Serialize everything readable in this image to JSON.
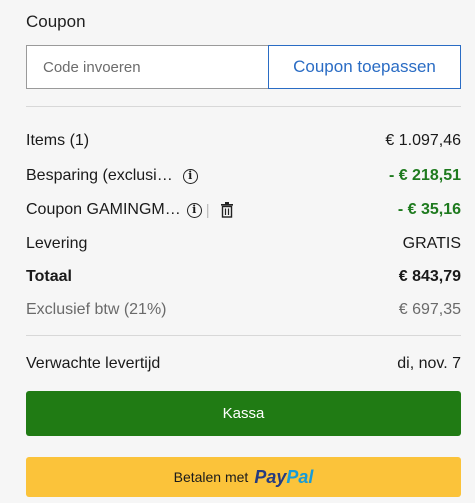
{
  "coupon": {
    "title": "Coupon",
    "input_placeholder": "Code invoeren",
    "input_value": "",
    "apply_label": "Coupon toepassen"
  },
  "summary": {
    "items_label": "Items (1)",
    "items_value": "€ 1.097,46",
    "savings_label": "Besparing (exclusi…",
    "savings_value": "- € 218,51",
    "coupon_label": "Coupon GAMINGM…",
    "coupon_sep": "|",
    "coupon_value": "- € 35,16",
    "delivery_label": "Levering",
    "delivery_value": "GRATIS",
    "total_label": "Totaal",
    "total_value": "€ 843,79",
    "vat_label": "Exclusief btw (21%)",
    "vat_value": "€ 697,35"
  },
  "delivery_estimate": {
    "label": "Verwachte levertijd",
    "value": "di, nov. 7"
  },
  "actions": {
    "checkout_label": "Kassa",
    "paypal_prefix": "Betalen met",
    "paypal_logo_part1": "Pay",
    "paypal_logo_part2": "Pal"
  },
  "icons": {
    "info": "info-icon",
    "trash": "trash-icon"
  },
  "colors": {
    "accent_blue": "#2a6cc4",
    "savings_green": "#1e7a1e",
    "checkout_green": "#207b14",
    "paypal_yellow": "#fbc33a"
  }
}
